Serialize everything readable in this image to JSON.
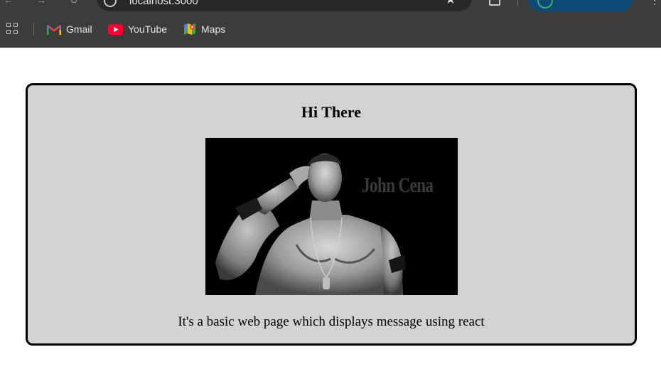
{
  "browser": {
    "url": "localhost:3000",
    "bookmarks": [
      {
        "label": "Gmail",
        "icon": "gmail-icon"
      },
      {
        "label": "YouTube",
        "icon": "youtube-icon"
      },
      {
        "label": "Maps",
        "icon": "maps-icon"
      }
    ],
    "colors": {
      "chrome_bg": "#3c3c3c",
      "omnibox_bg": "#282828",
      "profile_chip": "#0e4a75"
    }
  },
  "page": {
    "heading": "Hi There",
    "image_watermark": "John Cena",
    "message": "It's a basic web page which displays message using react",
    "colors": {
      "card_bg": "#d3d3d3",
      "card_border": "#000000"
    }
  }
}
